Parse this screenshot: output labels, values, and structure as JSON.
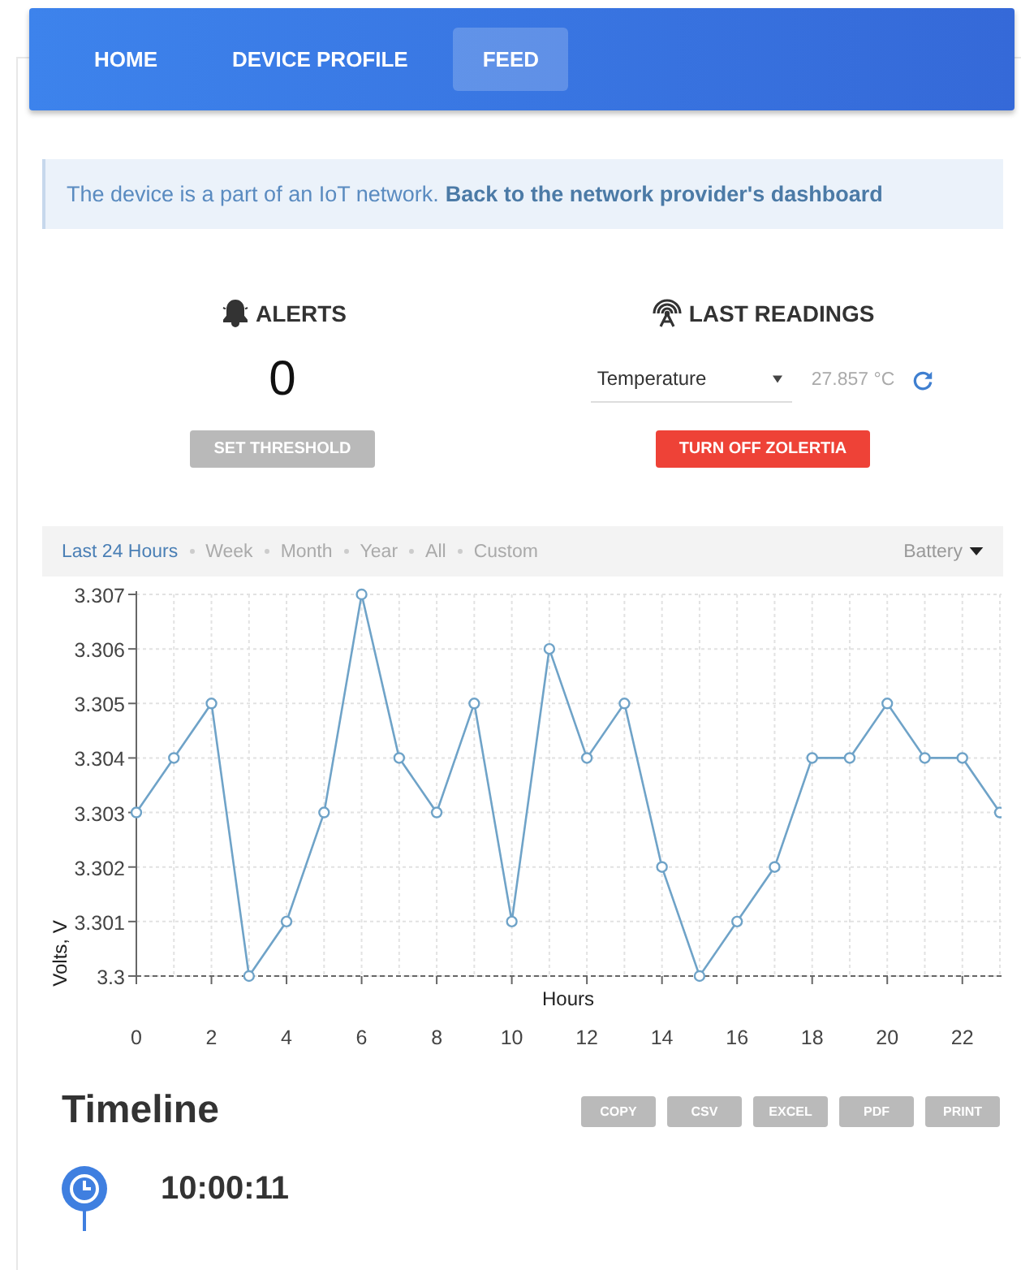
{
  "nav": {
    "tabs": [
      {
        "label": "HOME",
        "selected": false
      },
      {
        "label": "DEVICE PROFILE",
        "selected": false
      },
      {
        "label": "FEED",
        "selected": true
      }
    ]
  },
  "notice": {
    "text": "The device is a part of an IoT network.",
    "link": "Back to the network provider's dashboard"
  },
  "alerts": {
    "title": "ALERTS",
    "count": "0",
    "button": "SET THRESHOLD"
  },
  "last_readings": {
    "title": "LAST READINGS",
    "sensor": {
      "value": "Temperature"
    },
    "reading": "27.857 °C",
    "button": "TURN OFF ZOLERTIA"
  },
  "filters": {
    "ranges": [
      {
        "label": "Last 24 Hours",
        "selected": true
      },
      {
        "label": "Week",
        "selected": false
      },
      {
        "label": "Month",
        "selected": false
      },
      {
        "label": "Year",
        "selected": false
      },
      {
        "label": "All",
        "selected": false
      },
      {
        "label": "Custom",
        "selected": false
      }
    ],
    "metric": "Battery"
  },
  "chart": {
    "chart_data": {
      "type": "line",
      "xlabel": "Hours",
      "ylabel": "Volts, V",
      "x": [
        0,
        1,
        2,
        3,
        4,
        5,
        6,
        7,
        8,
        9,
        10,
        11,
        12,
        13,
        14,
        15,
        16,
        17,
        18,
        19,
        20,
        21,
        22,
        23
      ],
      "grid": true,
      "series": [
        {
          "color": "#6fa3c8",
          "marker": true,
          "values": [
            3.303,
            3.304,
            3.305,
            3.3,
            3.301,
            3.303,
            3.307,
            3.304,
            3.303,
            3.305,
            3.301,
            3.306,
            3.304,
            3.305,
            3.302,
            3.3,
            3.301,
            3.302,
            3.304,
            3.304,
            3.305,
            3.304,
            3.304,
            3.303
          ]
        }
      ],
      "xlim": [
        0,
        23
      ],
      "ylim": [
        3.3,
        3.307
      ],
      "xticks": [
        0,
        2,
        4,
        6,
        8,
        10,
        12,
        14,
        16,
        18,
        20,
        22
      ],
      "yticks": [
        {
          "value": 3.3,
          "label": "3.3"
        },
        {
          "value": 3.301,
          "label": "3.301"
        },
        {
          "value": 3.302,
          "label": "3.302"
        },
        {
          "value": 3.303,
          "label": "3.303"
        },
        {
          "value": 3.304,
          "label": "3.304"
        },
        {
          "value": 3.305,
          "label": "3.305"
        },
        {
          "value": 3.306,
          "label": "3.306"
        },
        {
          "value": 3.307,
          "label": "3.307"
        }
      ]
    }
  },
  "timeline": {
    "title": "Timeline",
    "exports": [
      "COPY",
      "CSV",
      "EXCEL",
      "PDF",
      "PRINT"
    ],
    "events": [
      {
        "time": "10:00:11"
      }
    ]
  }
}
